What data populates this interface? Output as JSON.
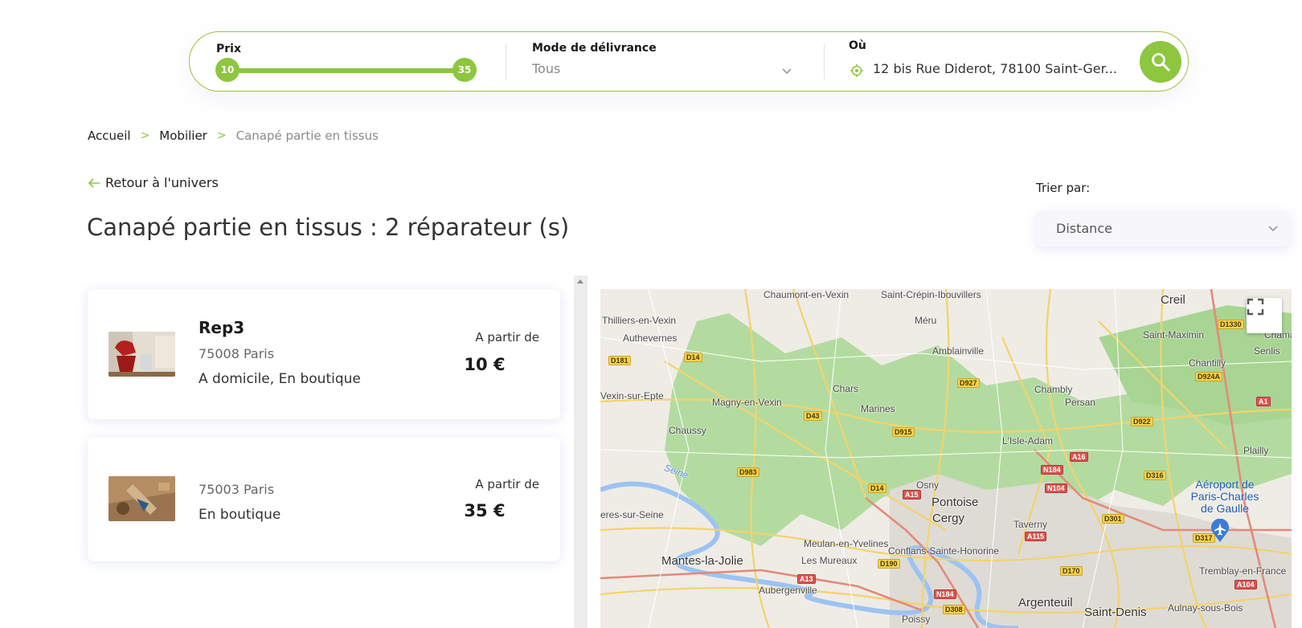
{
  "search": {
    "price_label": "Prix",
    "price_min": "10",
    "price_max": "35",
    "delivery_label": "Mode de délivrance",
    "delivery_value": "Tous",
    "location_label": "Où",
    "location_value": "12 bis Rue Diderot, 78100 Saint-Ger..."
  },
  "breadcrumb": {
    "items": [
      "Accueil",
      "Mobilier"
    ],
    "current": "Canapé partie en tissus",
    "separator": ">"
  },
  "back_link": "Retour à l'univers",
  "page_title": "Canapé partie en tissus : 2 réparateur (s)",
  "sort": {
    "label": "Trier par:",
    "value": "Distance"
  },
  "results": [
    {
      "name": "Rep3",
      "city": "75008 Paris",
      "modes": "A domicile, En boutique",
      "from_label": "A partir de",
      "price": "10 €"
    },
    {
      "name": "",
      "city": "75003 Paris",
      "modes": "En boutique",
      "from_label": "A partir de",
      "price": "35 €"
    }
  ],
  "map": {
    "places": [
      "Chaumont-en-Vexin",
      "Saint-Crépin-Ibouvillers",
      "Creil",
      "Thilliers-en-Vexin",
      "Méru",
      "Authevernes",
      "Saint-Maximin",
      "Chama",
      "Senlis",
      "Amblainville",
      "Chantilly",
      "Vexin-sur-Epte",
      "Chars",
      "Chambly",
      "Persan",
      "Magny-en-Vexin",
      "Marines",
      "Chaussy",
      "L'Isle-Adam",
      "Plailly",
      "Seine",
      "Osny",
      "Pontoise",
      "Aéroport de Paris-Charles de Gaulle",
      "Cergy",
      "Taverny",
      "eres-sur-Seine",
      "Meulan-en-Yvelines",
      "Conflans-Sainte-Honorine",
      "Mantes-la-Jolie",
      "Les Mureaux",
      "Tremblay-en-France",
      "Aubergenville",
      "Argenteuil",
      "Saint-Denis",
      "Aulnay-sous-Bois",
      "Poissy"
    ],
    "roads": [
      "D181",
      "D14",
      "D927",
      "D1330",
      "D924A",
      "A1",
      "D43",
      "D915",
      "D922",
      "A16",
      "N184",
      "D316",
      "D983",
      "D14",
      "A15",
      "N104",
      "D301",
      "D317",
      "A115",
      "D190",
      "A13",
      "D170",
      "N184",
      "D308",
      "A104"
    ]
  },
  "colors": {
    "accent": "#8dc63f",
    "map_green": "#b3dba0",
    "map_bg": "#efece6"
  }
}
